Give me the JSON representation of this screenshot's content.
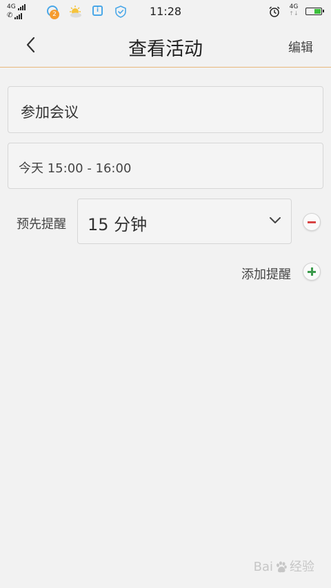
{
  "status_bar": {
    "signal1_label": "4G",
    "signal2_label": "✆",
    "qq_badge": "2",
    "time": "11:28",
    "net_label": "4G",
    "net_arrows": "↑↓",
    "battery_color": "#3cc03c"
  },
  "header": {
    "title": "查看活动",
    "edit_label": "编辑"
  },
  "event": {
    "title": "参加会议",
    "time": "今天 15:00 - 16:00"
  },
  "reminder": {
    "label": "预先提醒",
    "selected": "15 分钟",
    "add_label": "添加提醒"
  },
  "watermark": {
    "text_left": "Bai",
    "text_right": "经验"
  },
  "colors": {
    "background": "#f2f2f2",
    "header_underline": "#e8b77a",
    "remove_red": "#d84444",
    "add_green": "#3a9a4b"
  }
}
